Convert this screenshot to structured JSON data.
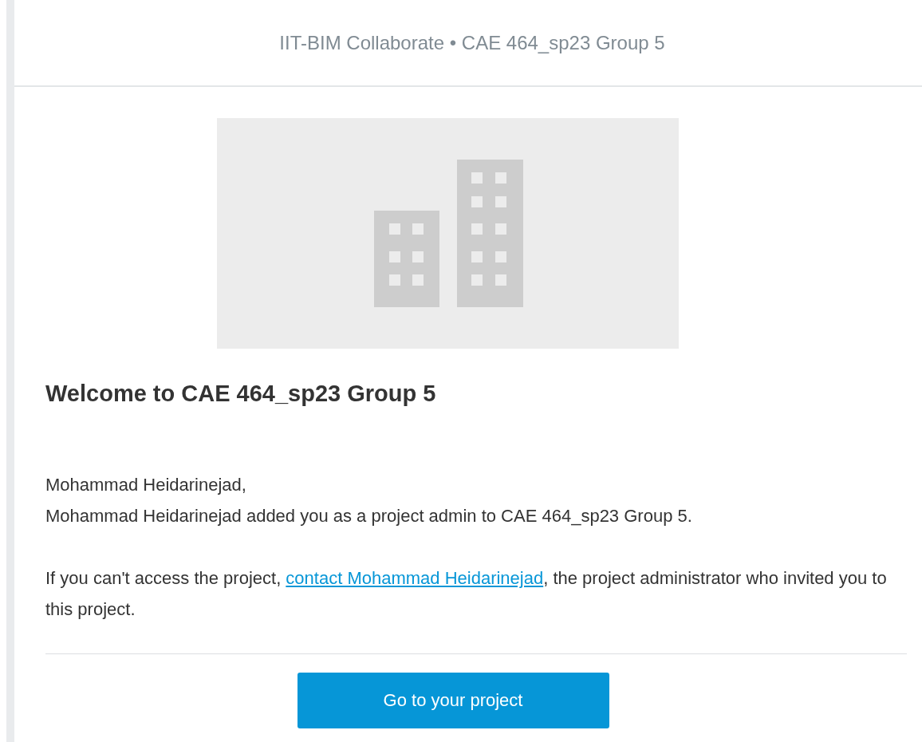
{
  "header": {
    "title": "IIT-BIM Collaborate • CAE 464_sp23 Group 5"
  },
  "heading": "Welcome to CAE 464_sp23 Group 5",
  "greeting": "Mohammad Heidarinejad,",
  "message": "Mohammad Heidarinejad added you as a project admin to CAE 464_sp23 Group 5.",
  "help": {
    "before": "If you can't access the project, ",
    "link": "contact Mohammad Heidarinejad",
    "after": ", the project administrator who invited you to this project."
  },
  "button": {
    "label": "Go to your project"
  }
}
